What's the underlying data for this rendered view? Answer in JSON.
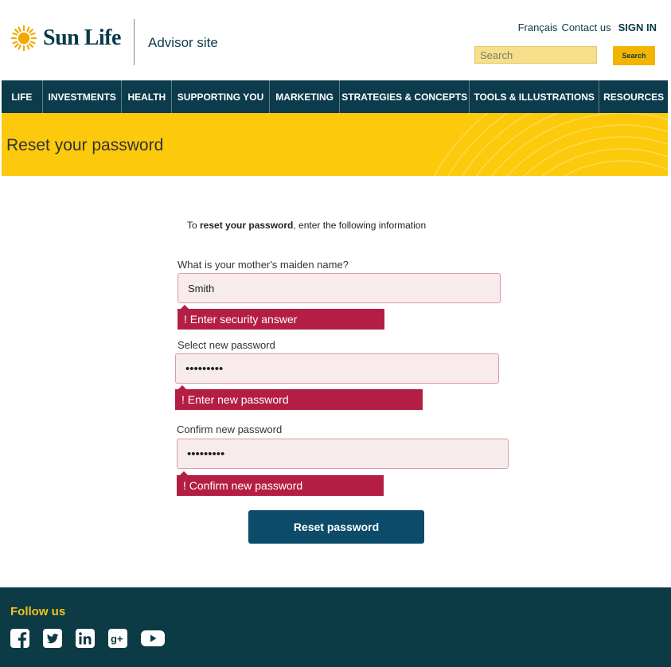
{
  "header": {
    "brand": "Sun Life",
    "site_name": "Advisor site",
    "links": {
      "francais": "Français",
      "contact": "Contact us",
      "signin": "SIGN IN"
    },
    "search": {
      "placeholder": "Search",
      "button_label": "Search"
    }
  },
  "nav": {
    "items": [
      {
        "label": "LIFE"
      },
      {
        "label": "INVESTMENTS"
      },
      {
        "label": "HEALTH"
      },
      {
        "label": "SUPPORTING YOU"
      },
      {
        "label": "MARKETING"
      },
      {
        "label": "STRATEGIES & CONCEPTS"
      },
      {
        "label": "TOOLS & ILLUSTRATIONS"
      },
      {
        "label": "RESOURCES"
      }
    ]
  },
  "banner": {
    "title": "Reset your password"
  },
  "form": {
    "intro_prefix": "To ",
    "intro_bold": "reset your password",
    "intro_suffix": ", enter the following information",
    "fields": [
      {
        "label": "What is your mother's maiden name?",
        "value": "Smith",
        "error": "! Enter security answer"
      },
      {
        "label": "Select new password",
        "value": "•••••••••",
        "error": "! Enter new password"
      },
      {
        "label": "Confirm new password",
        "value": "•••••••••",
        "error": "! Confirm new password"
      }
    ],
    "submit_label": "Reset password"
  },
  "footer": {
    "follow_label": "Follow us",
    "social_icons": [
      "facebook-icon",
      "twitter-icon",
      "linkedin-icon",
      "google-plus-icon",
      "youtube-icon"
    ]
  },
  "colors": {
    "navy": "#0c3b4b",
    "yellow": "#fcc90c",
    "error": "#b41e44",
    "button": "#0c4c6a",
    "footer_accent": "#f3c21c"
  }
}
